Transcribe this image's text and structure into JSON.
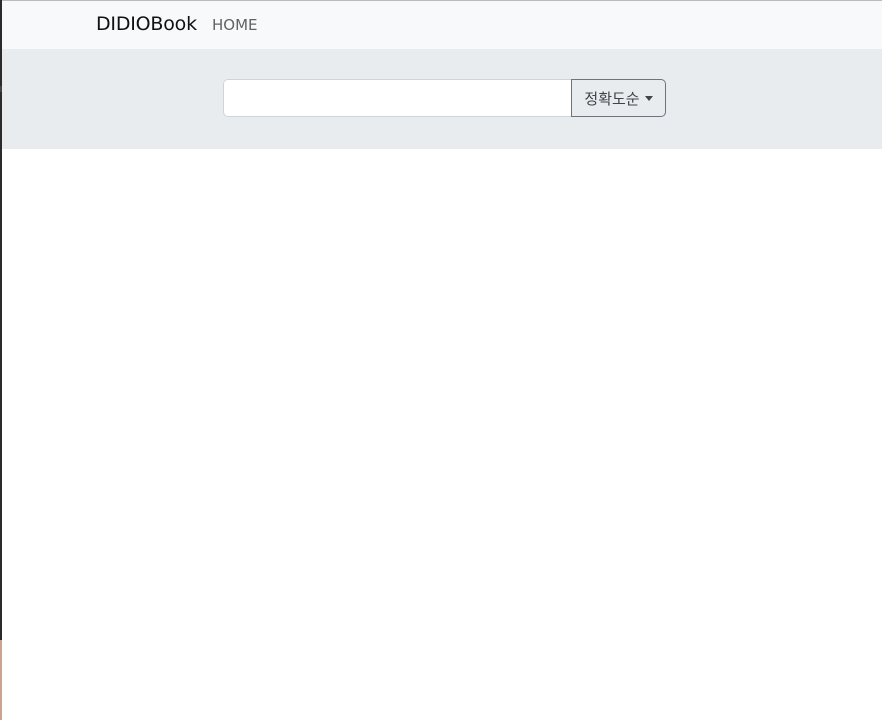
{
  "navbar": {
    "brand": "DIDIOBook",
    "home_label": "HOME"
  },
  "search": {
    "value": "",
    "placeholder": "",
    "sort_label": "정확도순",
    "sort_icon": "caret-down-icon"
  },
  "colors": {
    "navbar_bg": "#f8f9fa",
    "search_band_bg": "#e9ecef",
    "button_border": "#6c757d"
  }
}
